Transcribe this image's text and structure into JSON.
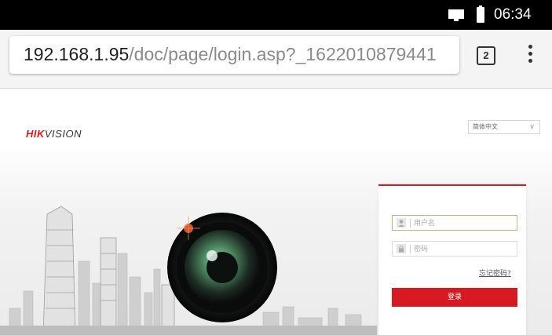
{
  "status_bar": {
    "time": "06:34",
    "icons": [
      "monitor-icon",
      "battery-icon"
    ]
  },
  "browser": {
    "url_host": "192.168.1.95",
    "url_path": "/doc/page/login.asp?_1622010879441",
    "tab_count": "2",
    "menu_icon": "more-vert-icon"
  },
  "header": {
    "logo_part1": "HIK",
    "logo_part2": "VISION",
    "language": "简体中文",
    "language_chevron": "∨"
  },
  "login": {
    "username_placeholder": "用户名",
    "password_placeholder": "密码",
    "forgot_password": "忘记密码?",
    "login_button": "登录"
  },
  "colors": {
    "brand_red": "#d71a21",
    "status_bar": "#000000",
    "toolbar_bg": "#f4f4f4"
  }
}
